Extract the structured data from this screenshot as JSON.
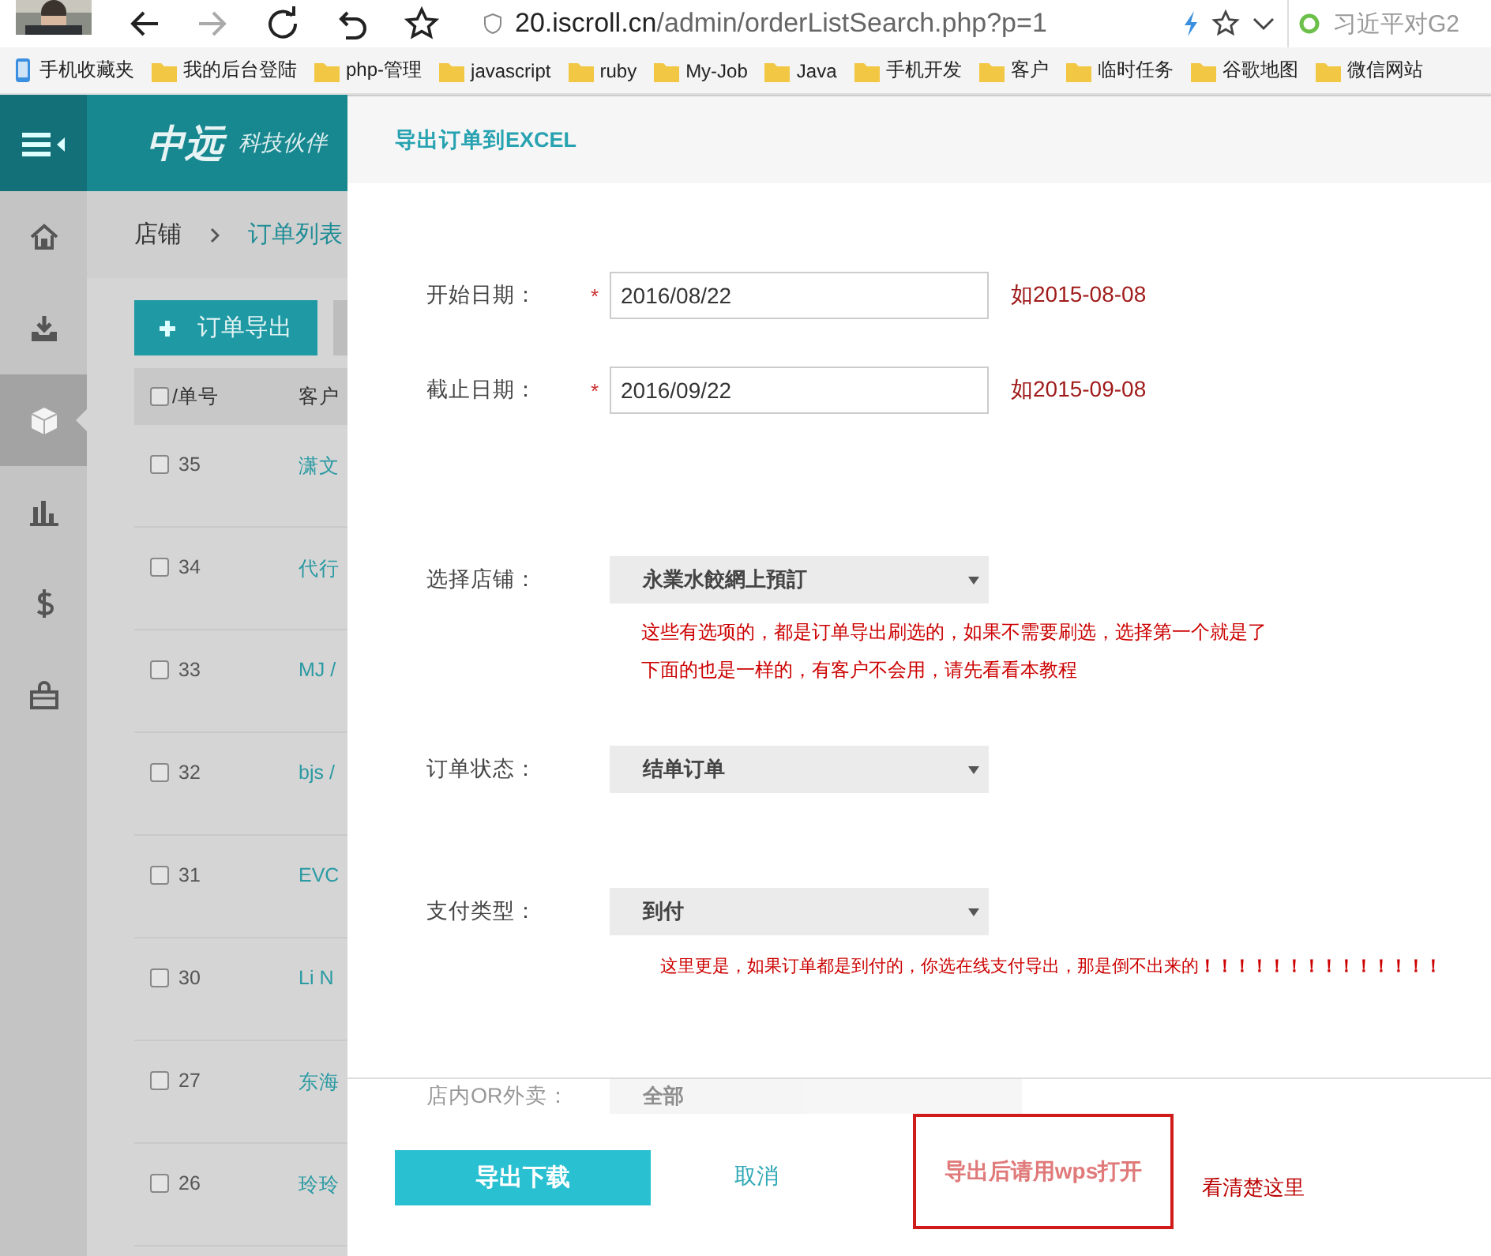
{
  "browser": {
    "url_host": "20.iscroll.cn",
    "url_path": "/admin/orderListSearch.php?p=1",
    "search_text": "习近平对G2",
    "bookmarks": [
      {
        "label": "手机收藏夹",
        "kind": "phone"
      },
      {
        "label": "我的后台登陆",
        "kind": "folder"
      },
      {
        "label": "php-管理",
        "kind": "folder"
      },
      {
        "label": "javascript",
        "kind": "folder"
      },
      {
        "label": "ruby",
        "kind": "folder"
      },
      {
        "label": "My-Job",
        "kind": "folder"
      },
      {
        "label": "Java",
        "kind": "folder"
      },
      {
        "label": "手机开发",
        "kind": "folder"
      },
      {
        "label": "客户",
        "kind": "folder"
      },
      {
        "label": "临时任务",
        "kind": "folder"
      },
      {
        "label": "谷歌地图",
        "kind": "folder"
      },
      {
        "label": "微信网站",
        "kind": "folder"
      }
    ]
  },
  "sidebar": {
    "items": [
      {
        "kind": "home",
        "selected": false
      },
      {
        "kind": "download",
        "selected": false
      },
      {
        "kind": "cube",
        "selected": true
      },
      {
        "kind": "chart",
        "selected": false
      },
      {
        "kind": "dollar",
        "selected": false
      },
      {
        "kind": "bag",
        "selected": false
      }
    ]
  },
  "header": {
    "logo": "中远",
    "logo_sub": "科技伙伴"
  },
  "breadcrumb": [
    "店铺",
    "订单列表"
  ],
  "toolbar": {
    "export_button": "订单导出"
  },
  "table": {
    "columns": [
      "/单号",
      "客户"
    ],
    "header_checked": false,
    "rows": [
      {
        "checked": false,
        "number": "35",
        "customer": "潇文"
      },
      {
        "checked": false,
        "number": "34",
        "customer": "代行"
      },
      {
        "checked": false,
        "number": "33",
        "customer": "MJ /"
      },
      {
        "checked": false,
        "number": "32",
        "customer": "bjs /"
      },
      {
        "checked": false,
        "number": "31",
        "customer": "EVC"
      },
      {
        "checked": false,
        "number": "30",
        "customer": "Li N"
      },
      {
        "checked": false,
        "number": "27",
        "customer": "东海"
      },
      {
        "checked": false,
        "number": "26",
        "customer": "玲玲"
      }
    ]
  },
  "dialog": {
    "title": "导出订单到EXCEL",
    "fields": [
      {
        "kind": "date",
        "label": "开始日期：",
        "marker": "*",
        "value": "2016/08/22",
        "hint": "如2015-08-08"
      },
      {
        "kind": "date",
        "label": "截止日期：",
        "marker": "*",
        "value": "2016/09/22",
        "hint": "如2015-09-08"
      },
      {
        "kind": "select",
        "label": "选择店铺：",
        "value": "永業水餃網上預訂",
        "notes": [
          "这些有选项的，都是订单导出刷选的，如果不需要刷选，选择第一个就是了",
          "下面的也是一样的，有客户不会用，请先看看本教程"
        ]
      },
      {
        "kind": "select",
        "label": "订单状态：",
        "value": "结单订单"
      },
      {
        "kind": "select",
        "label": "支付类型：",
        "value": "到付",
        "notes": [
          "这里更是，如果订单都是到付的，你选在线支付导出，那是倒不出来的**！！！！！！！！！！！！！！**"
        ]
      }
    ],
    "hidden_field": {
      "label": "店内OR外卖：",
      "value": "全部"
    },
    "submit": "导出下载",
    "cancel": "取消",
    "boxed_note": "导出后请用wps打开",
    "side_note": "看清楚这里"
  }
}
